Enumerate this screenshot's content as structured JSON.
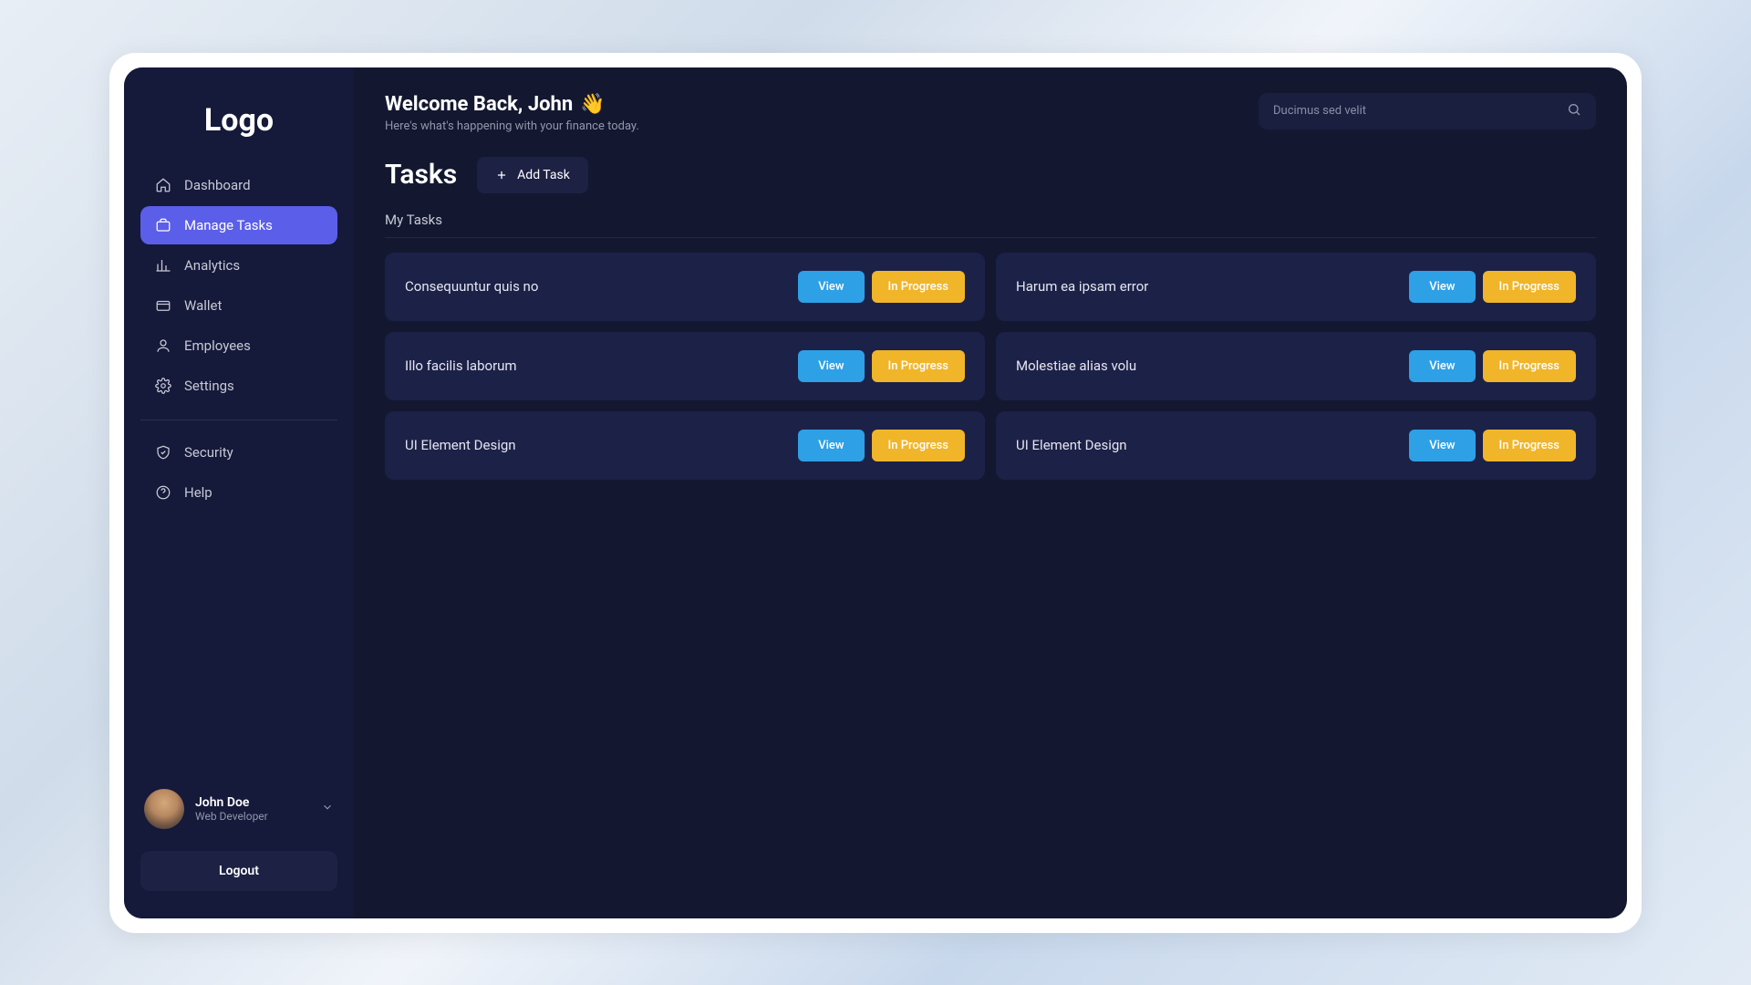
{
  "logo": "Logo",
  "sidebar": {
    "items": [
      {
        "label": "Dashboard"
      },
      {
        "label": "Manage Tasks"
      },
      {
        "label": "Analytics"
      },
      {
        "label": "Wallet"
      },
      {
        "label": "Employees"
      },
      {
        "label": "Settings"
      }
    ],
    "secondary": [
      {
        "label": "Security"
      },
      {
        "label": "Help"
      }
    ]
  },
  "user": {
    "name": "John Doe",
    "role": "Web Developer"
  },
  "logout": "Logout",
  "welcome": {
    "title": "Welcome Back, John",
    "emoji": "👋",
    "subtitle": "Here's what's happening with your finance today."
  },
  "search": {
    "placeholder": "Ducimus sed velit"
  },
  "page": {
    "title": "Tasks",
    "addTask": "Add Task",
    "subhead": "My Tasks"
  },
  "buttons": {
    "view": "View",
    "inProgress": "In Progress"
  },
  "tasks": [
    {
      "title": "Consequuntur quis no"
    },
    {
      "title": "Harum ea ipsam error"
    },
    {
      "title": "Illo facilis laborum"
    },
    {
      "title": "Molestiae alias volu"
    },
    {
      "title": "UI Element Design"
    },
    {
      "title": "UI Element Design"
    }
  ]
}
